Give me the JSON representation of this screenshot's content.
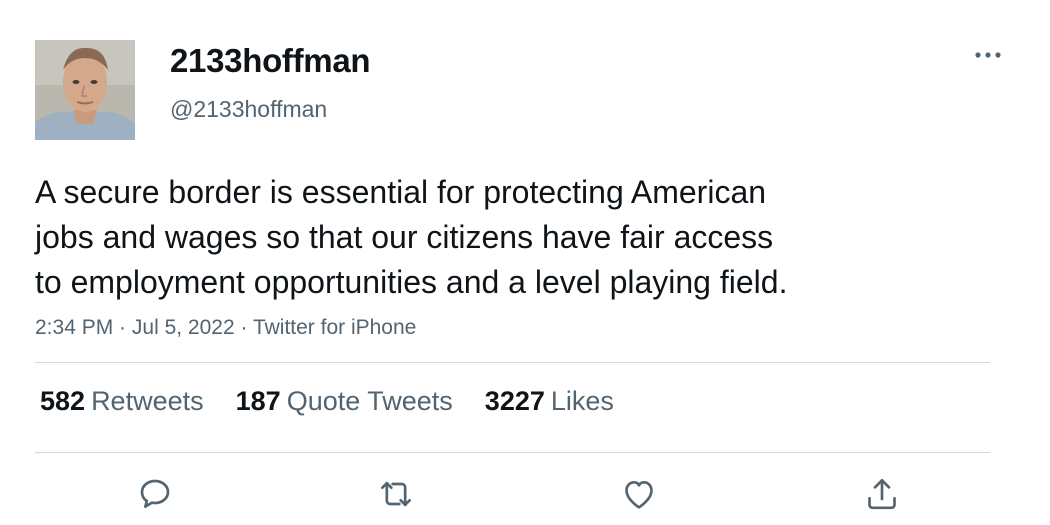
{
  "user": {
    "display_name": "2133hoffman",
    "handle": "@2133hoffman",
    "avatar_icon": "user-avatar-photo"
  },
  "tweet": {
    "text": "A secure border is essential for protecting American\njobs and wages so that our citizens have fair access\nto employment opportunities and a level playing field.",
    "time": "2:34 PM",
    "date": "Jul 5, 2022",
    "source": "Twitter for iPhone",
    "separator": " · "
  },
  "stats": {
    "retweets": {
      "count": "582",
      "label": "Retweets"
    },
    "quote_tweets": {
      "count": "187",
      "label": "Quote Tweets"
    },
    "likes": {
      "count": "3227",
      "label": "Likes"
    }
  },
  "actions": {
    "more_icon": "more-horizontal-icon",
    "reply_icon": "reply-icon",
    "retweet_icon": "retweet-icon",
    "like_icon": "heart-icon",
    "share_icon": "share-icon"
  },
  "colors": {
    "text_primary": "#0f1419",
    "text_secondary": "#536471",
    "divider": "#cfd9de"
  }
}
